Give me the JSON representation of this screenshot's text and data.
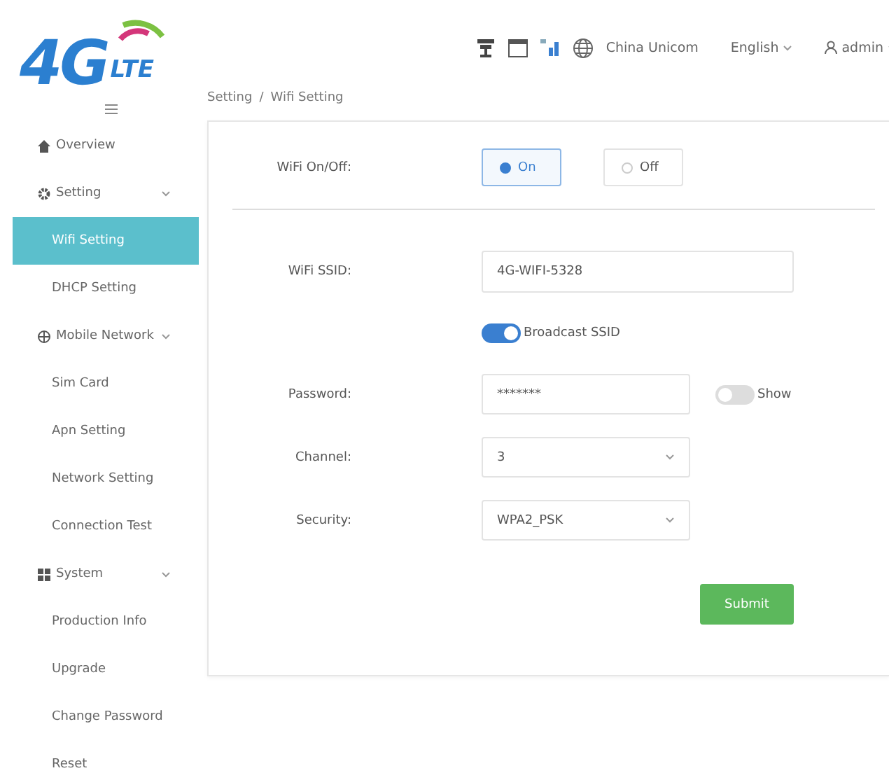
{
  "header": {
    "logo": {
      "main": "4G",
      "sub": "LTE"
    },
    "operator": "China Unicom",
    "language": "English",
    "user": "admin"
  },
  "breadcrumb": {
    "items": [
      "Setting",
      "Wifi Setting"
    ],
    "separator": "/"
  },
  "sidebar": {
    "items": [
      {
        "label": "Overview"
      },
      {
        "label": "Setting",
        "expanded": true,
        "children": [
          {
            "label": "Wifi Setting",
            "selected": true
          },
          {
            "label": "DHCP Setting",
            "selected": false
          }
        ]
      },
      {
        "label": "Mobile Network",
        "expanded": true,
        "children": [
          {
            "label": "Sim Card",
            "selected": false
          },
          {
            "label": "Apn Setting",
            "selected": false
          },
          {
            "label": "Network Setting",
            "selected": false
          },
          {
            "label": "Connection Test",
            "selected": false
          }
        ]
      },
      {
        "label": "System",
        "expanded": true,
        "children": [
          {
            "label": "Production Info",
            "selected": false
          },
          {
            "label": "Upgrade",
            "selected": false
          },
          {
            "label": "Change Password",
            "selected": false
          },
          {
            "label": "Reset",
            "selected": false
          }
        ]
      }
    ]
  },
  "form": {
    "wifi_switch": {
      "label": "WiFi On/Off:",
      "options": [
        {
          "label": "On",
          "selected": true
        },
        {
          "label": "Off",
          "selected": false
        }
      ]
    },
    "fields": [
      {
        "kind": "text",
        "label": "WiFi SSID:",
        "value": "4G-WIFI-5328"
      },
      {
        "kind": "switch",
        "label": "Broadcast SSID",
        "on": true
      },
      {
        "kind": "password",
        "label": "Password:",
        "value": "*******",
        "show_label": "Show",
        "show_on": false
      },
      {
        "kind": "select",
        "label": "Channel:",
        "value": "3"
      },
      {
        "kind": "select",
        "label": "Security:",
        "value": "WPA2_PSK"
      }
    ],
    "submit": "Submit"
  }
}
